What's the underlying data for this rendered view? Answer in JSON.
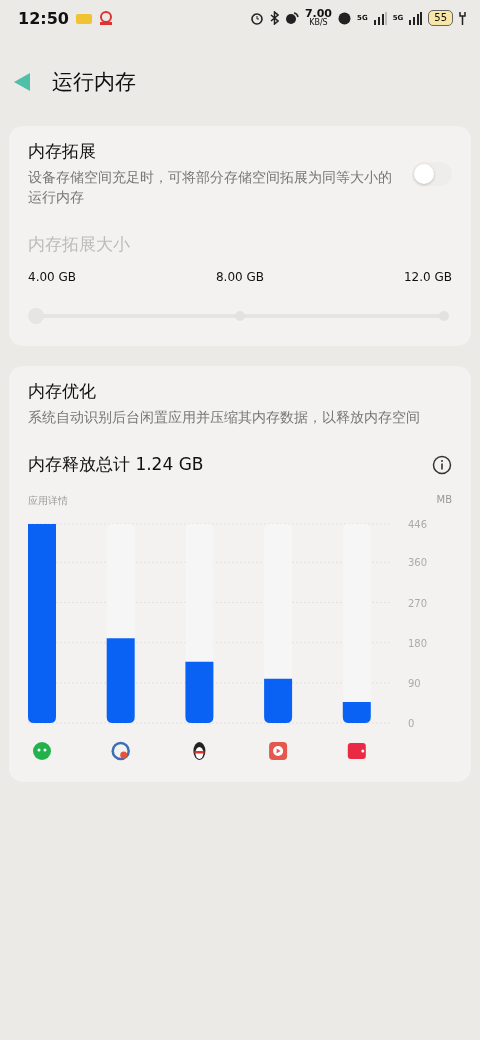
{
  "status_bar": {
    "time": "12:50",
    "net_speed": "7.00",
    "net_unit": "KB/S",
    "signal_1": "5G",
    "signal_2": "5G",
    "battery": "55"
  },
  "header": {
    "title": "运行内存"
  },
  "expansion": {
    "title": "内存拓展",
    "description": "设备存储空间充足时，可将部分存储空间拓展为同等大小的运行内存",
    "on": false,
    "size_label": "内存拓展大小",
    "disabled": true,
    "slider": {
      "marks": [
        "4.00 GB",
        "8.00 GB",
        "12.0 GB"
      ],
      "level": 0
    }
  },
  "optimization": {
    "title": "内存优化",
    "description": "系统自动识别后台闲置应用并压缩其内存数据，以释放内存空间",
    "total": "内存释放总计 1.24 GB",
    "chart_data": {
      "type": "bar",
      "title": "应用详情",
      "ylabel": "MB",
      "values": [
        446,
        190,
        137,
        99,
        47
      ],
      "ylim": [
        0,
        446
      ],
      "grid": true,
      "yticks": [
        0,
        90,
        180,
        270,
        360,
        446
      ]
    }
  }
}
